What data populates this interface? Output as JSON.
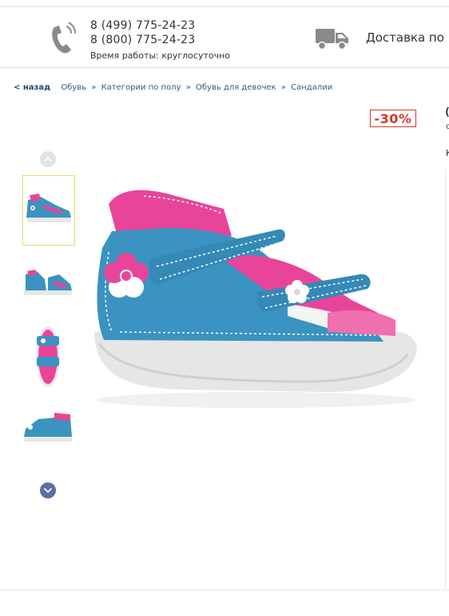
{
  "header": {
    "phone1": "8 (499) 775-24-23",
    "phone2": "8 (800) 775-24-23",
    "hours": "Время работы: круглосуточно",
    "delivery": "Доставка по"
  },
  "breadcrumb": {
    "back": "< назад",
    "items": [
      "Обувь",
      "Категории по полу",
      "Обувь для девочек",
      "Сандалии"
    ],
    "separator": "»"
  },
  "product": {
    "discount": "-30%",
    "gallery_active_index": 0,
    "thumbnail_count": 4
  },
  "colors": {
    "accent_blue": "#1f4670",
    "discount_red": "#d9362b",
    "sandal_blue": "#3a93c0",
    "sandal_pink": "#e8459a"
  }
}
